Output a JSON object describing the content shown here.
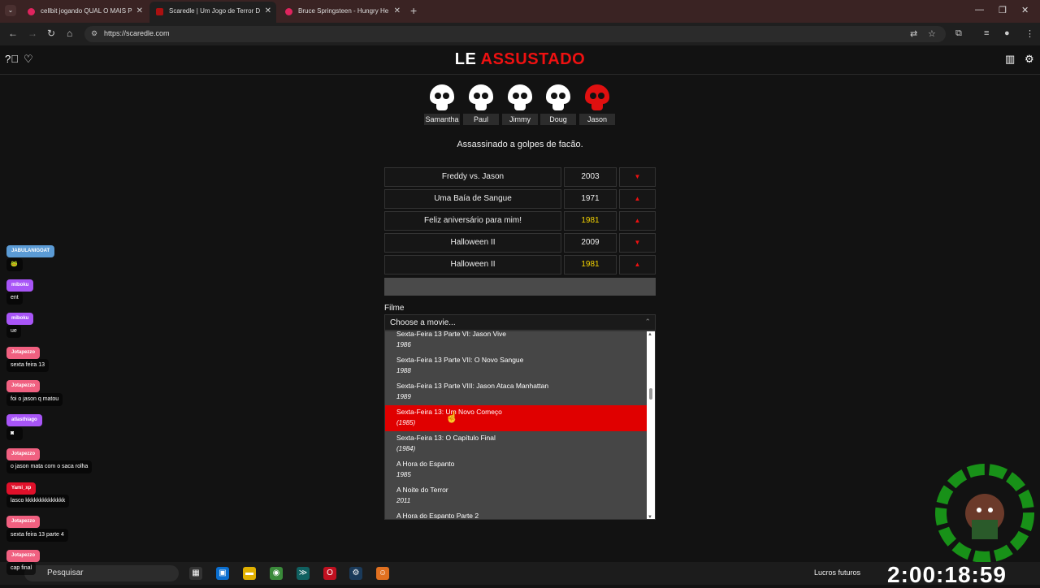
{
  "browser": {
    "tabs": [
      {
        "title": "cellbit jogando QUAL O MAIS P"
      },
      {
        "title": "Scaredle | Um Jogo de Terror D"
      },
      {
        "title": "Bruce Springsteen - Hungry He"
      }
    ],
    "url": "https://scaredle.com"
  },
  "header": {
    "logo_part1": "LE",
    "logo_part2": "ASSUSTADO"
  },
  "suspects": [
    {
      "name": "Samantha",
      "state": "safe"
    },
    {
      "name": "Paul",
      "state": "safe"
    },
    {
      "name": "Jimmy",
      "state": "safe"
    },
    {
      "name": "Doug",
      "state": "safe"
    },
    {
      "name": "Jason",
      "state": "revealed"
    }
  ],
  "clue": "Assassinado a golpes de facão.",
  "guesses": [
    {
      "title": "Freddy vs. Jason",
      "year": "2003",
      "direction": "down",
      "year_close": false
    },
    {
      "title": "Uma Baía de Sangue",
      "year": "1971",
      "direction": "up",
      "year_close": false
    },
    {
      "title": "Feliz aniversário para mim!",
      "year": "1981",
      "direction": "up",
      "year_close": true
    },
    {
      "title": "Halloween II",
      "year": "2009",
      "direction": "down",
      "year_close": false
    },
    {
      "title": "Halloween II",
      "year": "1981",
      "direction": "up",
      "year_close": true
    }
  ],
  "form": {
    "label": "Filme",
    "placeholder": "Choose a movie..."
  },
  "options": [
    {
      "title": "Sexta-Feira 13 Parte VI: Jason Vive",
      "year": "1986",
      "highlighted": false
    },
    {
      "title": "Sexta-Feira 13 Parte VII: O Novo Sangue",
      "year": "1988",
      "highlighted": false
    },
    {
      "title": "Sexta-Feira 13 Parte VIII: Jason Ataca Manhattan",
      "year": "1989",
      "highlighted": false
    },
    {
      "title": "Sexta-Feira 13: Um Novo Começo",
      "year": "(1985)",
      "highlighted": true
    },
    {
      "title": "Sexta-Feira 13: O Capítulo Final",
      "year": "(1984)",
      "highlighted": false
    },
    {
      "title": "A Hora do Espanto",
      "year": "1985",
      "highlighted": false
    },
    {
      "title": "A Noite do Terror",
      "year": "2011",
      "highlighted": false
    },
    {
      "title": "A Hora do Espanto Parte 2",
      "year": "",
      "highlighted": false
    }
  ],
  "chat": [
    {
      "user": "JABULANIGOAT",
      "msg": "",
      "color": "#5b9bd5"
    },
    {
      "user": "miboku",
      "msg": "ent",
      "color": "#a855f7"
    },
    {
      "user": "miboku",
      "msg": "ue",
      "color": "#a855f7"
    },
    {
      "user": "Jotapezzo",
      "msg": "sexta feira 13",
      "color": "#f06080"
    },
    {
      "user": "Jotapezzo",
      "msg": "foi o jason q matou",
      "color": "#f06080"
    },
    {
      "user": "atlasthiago",
      "msg": "",
      "color": "#a855f7"
    },
    {
      "user": "Jotapezzo",
      "msg": "o jason mata com o saca rolha",
      "color": "#f06080"
    },
    {
      "user": "Yami_xp",
      "msg": "lasco kkkkkkkkkkkkkk",
      "color": "#e0102a"
    },
    {
      "user": "Jotapezzo",
      "msg": "sexta feira 13 parte 4",
      "color": "#f06080"
    },
    {
      "user": "Jotapezzo",
      "msg": "cap final",
      "color": "#f06080"
    }
  ],
  "taskbar": {
    "search_label": "Pesquisar",
    "news": "Lucros futuros",
    "clock": "2:00:18:59"
  },
  "colors": {
    "accent_red": "#e11111",
    "close_yellow": "#f5d400"
  }
}
